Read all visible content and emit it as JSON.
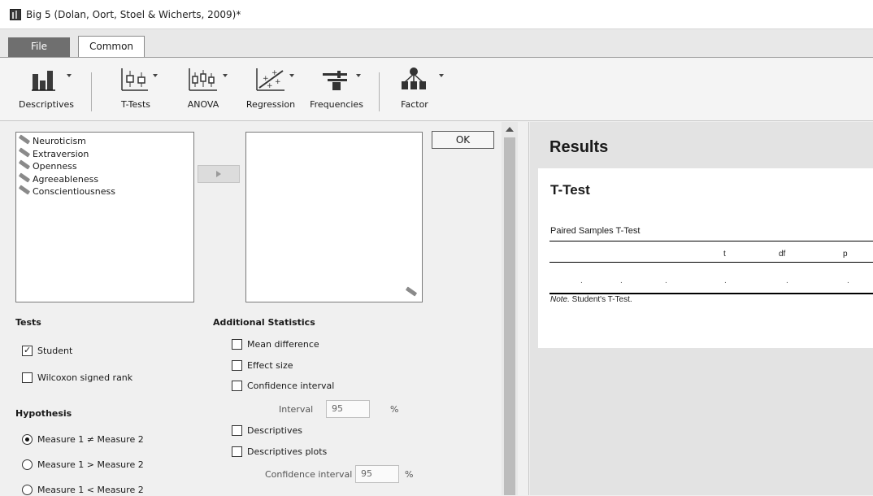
{
  "window": {
    "title": "Big 5 (Dolan, Oort, Stoel & Wicherts, 2009)*"
  },
  "tabs": {
    "file": "File",
    "common": "Common"
  },
  "ribbon": [
    {
      "label": "Descriptives",
      "icon": "descriptives-bar-chart-icon"
    },
    {
      "label": "T-Tests",
      "icon": "t-tests-boxplot-icon"
    },
    {
      "label": "ANOVA",
      "icon": "anova-boxplot-icon"
    },
    {
      "label": "Regression",
      "icon": "regression-scatter-icon"
    },
    {
      "label": "Frequencies",
      "icon": "frequencies-icon"
    },
    {
      "label": "Factor",
      "icon": "factor-tree-icon"
    }
  ],
  "variables": [
    "Neuroticism",
    "Extraversion",
    "Openness",
    "Agreeableness",
    "Conscientiousness"
  ],
  "ok_label": "OK",
  "tests": {
    "title": "Tests",
    "student": {
      "label": "Student",
      "checked": true
    },
    "wilcoxon": {
      "label": "Wilcoxon signed rank",
      "checked": false
    }
  },
  "hypothesis": {
    "title": "Hypothesis",
    "options": [
      {
        "label": "Measure 1 ≠ Measure 2",
        "selected": true
      },
      {
        "label": "Measure 1 > Measure 2",
        "selected": false
      },
      {
        "label": "Measure 1 < Measure 2",
        "selected": false
      }
    ]
  },
  "additional": {
    "title": "Additional Statistics",
    "mean_difference": "Mean difference",
    "effect_size": "Effect size",
    "confidence_interval": "Confidence interval",
    "interval_label": "Interval",
    "interval_value": "95",
    "percent": "%",
    "descriptives": "Descriptives",
    "descriptives_plots": "Descriptives plots",
    "plots_ci_label": "Confidence interval",
    "plots_ci_value": "95"
  },
  "results": {
    "title": "Results",
    "heading": "T-Test",
    "caption": "Paired Samples T-Test",
    "columns": [
      "t",
      "df",
      "p"
    ],
    "row": [
      ".",
      ".",
      ".",
      ".",
      ".",
      "."
    ],
    "note_prefix": "Note.",
    "note_text": " Student's T-Test."
  }
}
